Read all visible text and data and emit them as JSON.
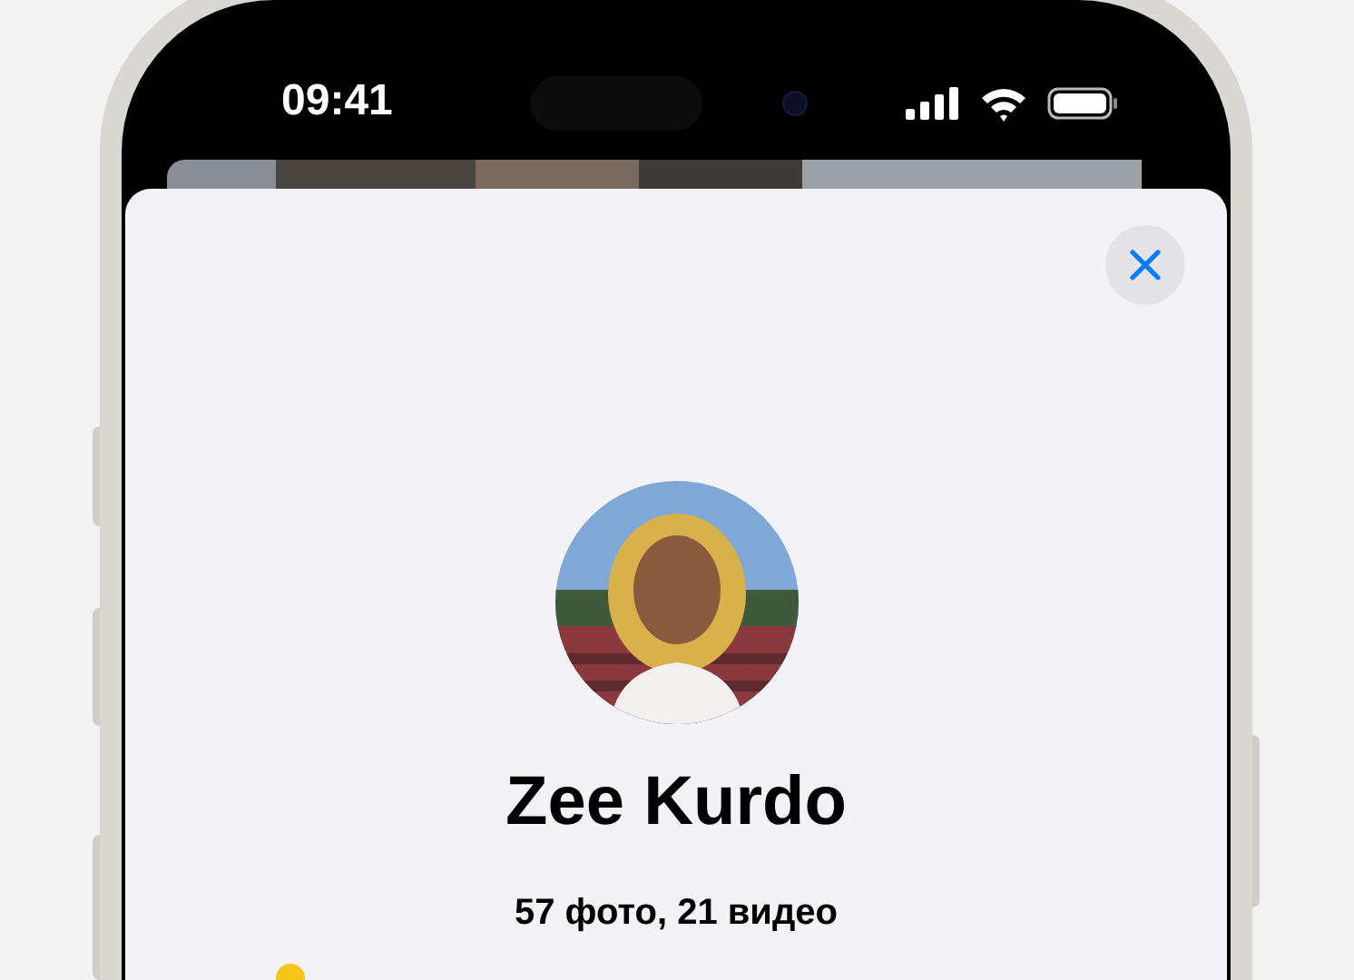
{
  "status_bar": {
    "time": "09:41"
  },
  "sheet": {
    "name": "Zee Kurdo",
    "subtitle": "57 фото, 21 видео"
  }
}
